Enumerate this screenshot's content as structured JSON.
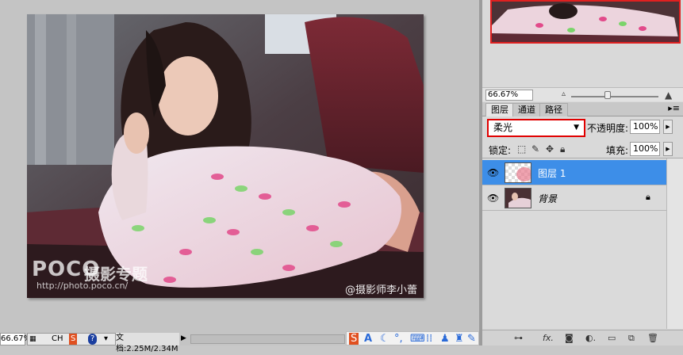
{
  "document": {
    "watermark_logo": "POCO",
    "watermark_cn": "摄影专题",
    "watermark_url": "http://photo.poco.cn/",
    "credit": "@摄影师李小蕾"
  },
  "navigator": {
    "zoom": "66.67%"
  },
  "layers_panel": {
    "tabs": [
      {
        "label": "图层",
        "active": true
      },
      {
        "label": "通道",
        "active": false
      },
      {
        "label": "路径",
        "active": false
      }
    ],
    "menu_icon": "panel-menu-icon",
    "blend_mode": "柔光",
    "opacity_label": "不透明度:",
    "opacity_value": "100%",
    "lock_label": "锁定:",
    "fill_label": "填充:",
    "fill_value": "100%",
    "layers": [
      {
        "name": "图层 1",
        "selected": true
      },
      {
        "name": "背景",
        "selected": false
      }
    ]
  },
  "status_bar": {
    "zoom": "66.67%",
    "ime_ch": "CH",
    "doc_size": "文档:2.25M/2.34M"
  },
  "colors": {
    "highlight": "#e00000",
    "selected_layer": "#3d8ee8",
    "panel_bg": "#d9d9d9"
  }
}
